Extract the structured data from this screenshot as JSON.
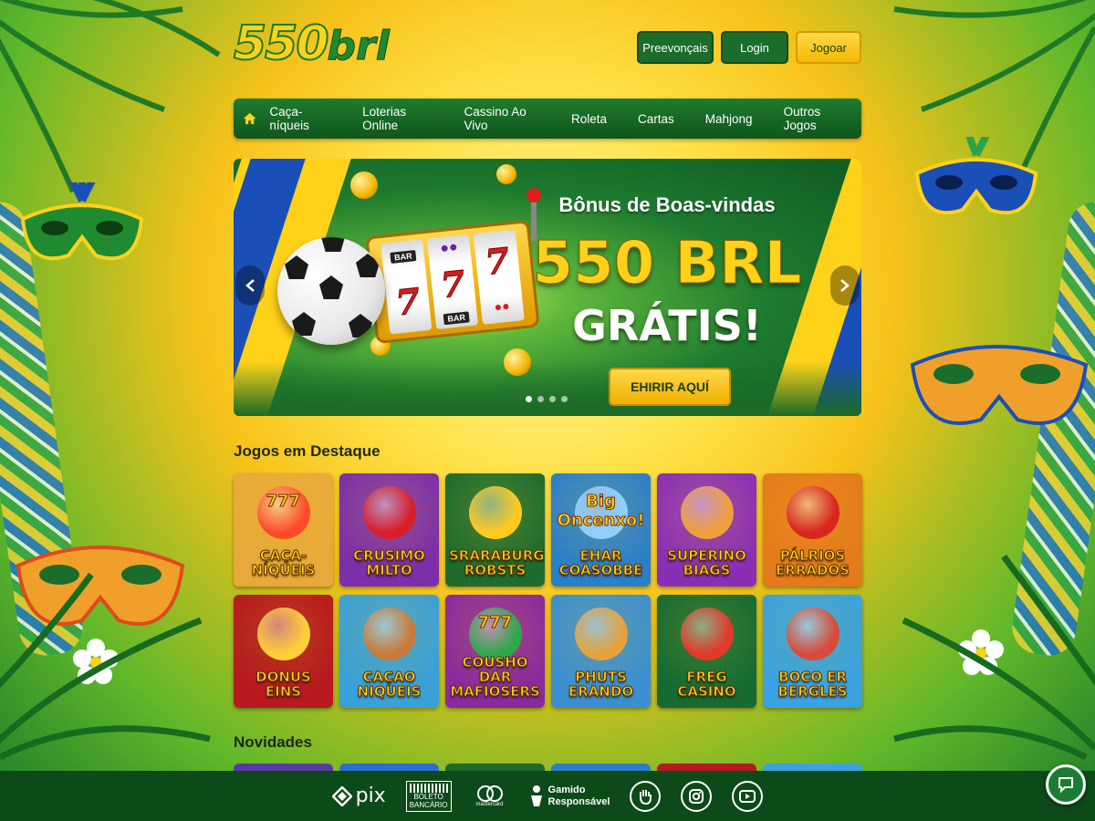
{
  "brand": {
    "logo_number": "550",
    "logo_suffix": "brl"
  },
  "header": {
    "register_label": "Preevoncais",
    "login_label": "Login",
    "play_label": "Jogoar"
  },
  "header_display": {
    "register_label": "Preevonçais",
    "play_label": "Jogoar"
  },
  "nav": {
    "home_icon": "home-icon",
    "items": [
      "Caça-níqueis",
      "Loterias Online",
      "Cassino Ao Vivo",
      "Roleta",
      "Cartas",
      "Mahjong",
      "Outros Jogos"
    ]
  },
  "banner": {
    "subtitle": "Bônus de Boas-vindas",
    "amount": "550 BRL",
    "free": "GRÁTIS!",
    "cta": "EHIRIR AQUÍ",
    "reel_bar": "BAR",
    "reel_seven": "7",
    "slides": 4,
    "active_slide": 1
  },
  "featured": {
    "title": "Jogos em Destaque",
    "games": [
      {
        "title": "CAÇA-NÍQUEIS",
        "top": "777",
        "bg": "#e8a93a",
        "art": "#ff4a2a"
      },
      {
        "title": "CRUSIMO MILTO",
        "top": "",
        "bg": "#7b2fa8",
        "art": "#d81e2a"
      },
      {
        "title": "SRARABURG ROBSTS",
        "top": "",
        "bg": "#1e6b2c",
        "art": "#ffcb21"
      },
      {
        "title": "EHAR COASOBBE",
        "top": "Big Oncenxo!",
        "bg": "#2b7fc7",
        "art": "#8fd0ff"
      },
      {
        "title": "SUPERINO BIAGS",
        "top": "",
        "bg": "#8a2fb5",
        "art": "#f0a03a"
      },
      {
        "title": "PÁLRIOS ERRADOS",
        "top": "",
        "bg": "#e57a1c",
        "art": "#d8261e"
      },
      {
        "title": "DONUS EINS",
        "top": "",
        "bg": "#b8191e",
        "art": "#ffcf3a"
      },
      {
        "title": "CAÇAO NIQUEIS",
        "top": "",
        "bg": "#3aa0d8",
        "art": "#c97a3a"
      },
      {
        "title": "COUSHO DAR MAFIOSERS",
        "top": "777",
        "bg": "#8a2a9c",
        "art": "#2fa84a"
      },
      {
        "title": "PHUTS ERANDO",
        "top": "",
        "bg": "#3b8fd0",
        "art": "#e5a23a"
      },
      {
        "title": "FREG CASINO",
        "top": "",
        "bg": "#166b33",
        "art": "#e23a2a"
      },
      {
        "title": "BOCO ER BERGLES",
        "top": "",
        "bg": "#3aa2e0",
        "art": "#d84a3a"
      }
    ]
  },
  "novidades": {
    "title": "Novidades",
    "strip_colors": [
      "#5a3aa0",
      "#2a6fd0",
      "#1e6b2c",
      "#2a80c8",
      "#b8191e",
      "#3aa2e0"
    ]
  },
  "footer": {
    "pix": "pix",
    "boleto_line1": "BOLETO",
    "boleto_line2": "BANCÁRIO",
    "mastercard": "mastercard",
    "responsible_line1": "Gamido",
    "responsible_line2": "Responsável"
  },
  "colors": {
    "primary_green": "#1a6d2a",
    "accent_gold": "#ffd21a"
  }
}
